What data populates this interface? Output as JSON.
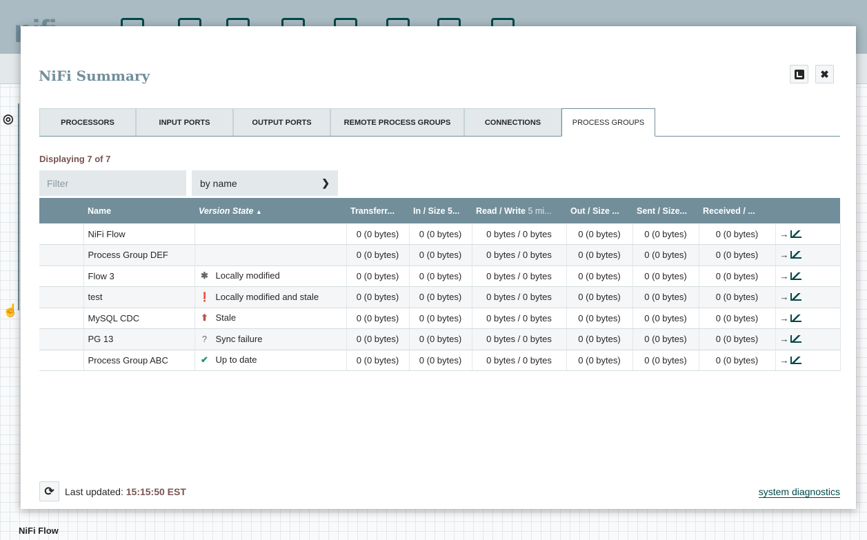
{
  "app": {
    "bottom_label": "NiFi Flow"
  },
  "dialog": {
    "title": "NiFi Summary",
    "popout_icon": "popout-icon",
    "close_icon": "close-icon"
  },
  "tabs": [
    {
      "label": "PROCESSORS",
      "active": false
    },
    {
      "label": "INPUT PORTS",
      "active": false
    },
    {
      "label": "OUTPUT PORTS",
      "active": false
    },
    {
      "label": "REMOTE PROCESS GROUPS",
      "active": false
    },
    {
      "label": "CONNECTIONS",
      "active": false
    },
    {
      "label": "PROCESS GROUPS",
      "active": true
    }
  ],
  "summary": {
    "displaying": "Displaying 7 of 7",
    "filter_placeholder": "Filter",
    "filter_by": "by name"
  },
  "table": {
    "columns": {
      "name": "Name",
      "version_state": "Version State",
      "transferred": "Transferr...",
      "in": "In / Size 5...",
      "read_write": "Read / Write",
      "read_write_sub": "5 mi...",
      "out": "Out / Size ...",
      "sent": "Sent / Size...",
      "received": "Received / ..."
    },
    "rows": [
      {
        "name": "NiFi Flow",
        "state": "",
        "state_icon": "",
        "transferred": "0 (0 bytes)",
        "in": "0 (0 bytes)",
        "read_write": "0 bytes / 0 bytes",
        "out": "0 (0 bytes)",
        "sent": "0 (0 bytes)",
        "received": "0 (0 bytes)"
      },
      {
        "name": "Process Group DEF",
        "state": "",
        "state_icon": "",
        "transferred": "0 (0 bytes)",
        "in": "0 (0 bytes)",
        "read_write": "0 bytes / 0 bytes",
        "out": "0 (0 bytes)",
        "sent": "0 (0 bytes)",
        "received": "0 (0 bytes)"
      },
      {
        "name": "Flow 3",
        "state": "Locally modified",
        "state_icon": "asterisk-icon",
        "transferred": "0 (0 bytes)",
        "in": "0 (0 bytes)",
        "read_write": "0 bytes / 0 bytes",
        "out": "0 (0 bytes)",
        "sent": "0 (0 bytes)",
        "received": "0 (0 bytes)"
      },
      {
        "name": "test",
        "state": "Locally modified and stale",
        "state_icon": "exclamation-circle-icon",
        "transferred": "0 (0 bytes)",
        "in": "0 (0 bytes)",
        "read_write": "0 bytes / 0 bytes",
        "out": "0 (0 bytes)",
        "sent": "0 (0 bytes)",
        "received": "0 (0 bytes)"
      },
      {
        "name": "MySQL CDC",
        "state": "Stale",
        "state_icon": "arrow-up-circle-icon",
        "transferred": "0 (0 bytes)",
        "in": "0 (0 bytes)",
        "read_write": "0 bytes / 0 bytes",
        "out": "0 (0 bytes)",
        "sent": "0 (0 bytes)",
        "received": "0 (0 bytes)"
      },
      {
        "name": "PG 13",
        "state": "Sync failure",
        "state_icon": "question-icon",
        "transferred": "0 (0 bytes)",
        "in": "0 (0 bytes)",
        "read_write": "0 bytes / 0 bytes",
        "out": "0 (0 bytes)",
        "sent": "0 (0 bytes)",
        "received": "0 (0 bytes)"
      },
      {
        "name": "Process Group ABC",
        "state": "Up to date",
        "state_icon": "check-icon",
        "transferred": "0 (0 bytes)",
        "in": "0 (0 bytes)",
        "read_write": "0 bytes / 0 bytes",
        "out": "0 (0 bytes)",
        "sent": "0 (0 bytes)",
        "received": "0 (0 bytes)"
      }
    ]
  },
  "footer": {
    "last_updated_label": "Last updated:",
    "last_updated_time": "15:15:50 EST",
    "system_diagnostics": "system diagnostics"
  },
  "colors": {
    "header": "#728e9b",
    "accent": "#004849",
    "label": "#775351"
  }
}
